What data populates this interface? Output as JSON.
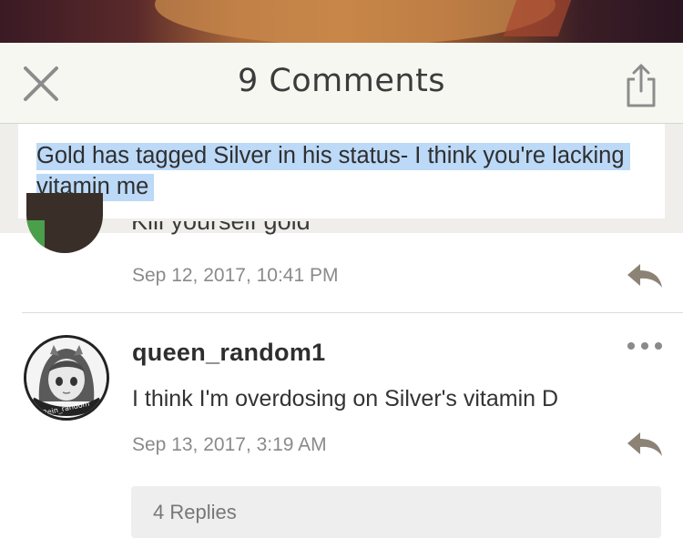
{
  "header": {
    "title": "9 Comments",
    "close_icon": "close-icon",
    "share_icon": "share-icon"
  },
  "status": {
    "text": "Gold has tagged Silver in his status- I think you're lacking vitamin me",
    "highlight_color": "#bcd9f7"
  },
  "comments": [
    {
      "text": "Kill yourself gold",
      "timestamp": "Sep 12, 2017, 10:41 PM"
    },
    {
      "username": "queen_random1",
      "text": "I think I'm overdosing on Silver's vitamin D",
      "timestamp": "Sep 13, 2017, 3:19 AM",
      "avatar_caption": "Rein_random",
      "replies_label": "4 Replies"
    }
  ],
  "colors": {
    "header_bg": "#f7f7f2",
    "icon_gray": "#8c8c8c",
    "reply_icon": "#8c8276"
  }
}
